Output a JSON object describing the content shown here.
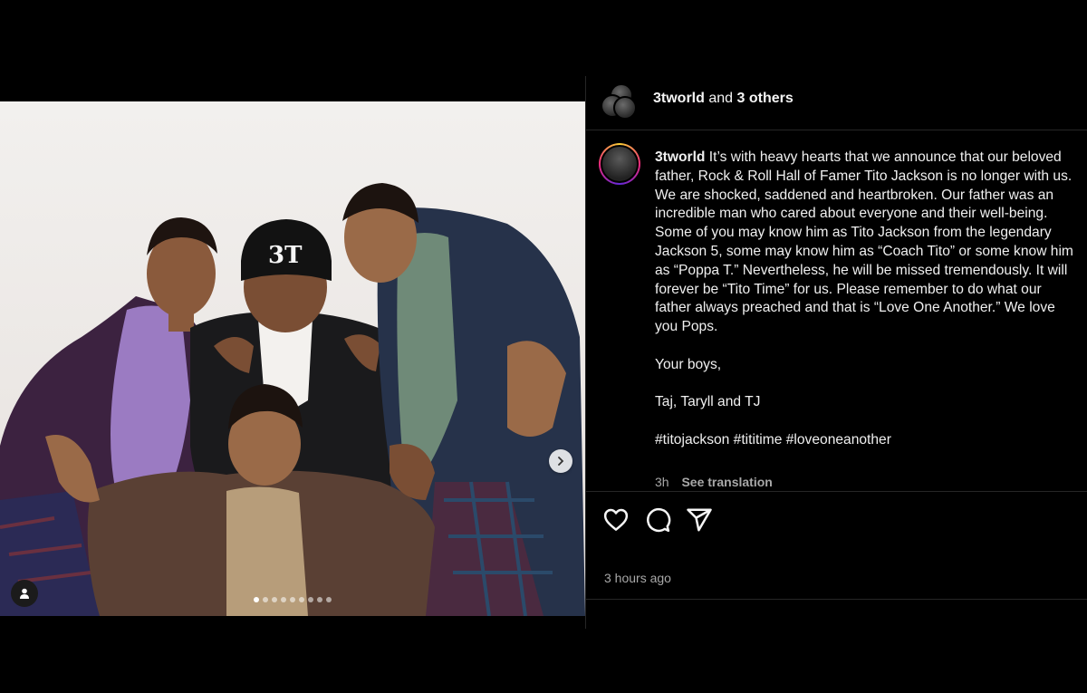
{
  "header": {
    "username": "3tworld",
    "connector": "and",
    "others": "3 others"
  },
  "post": {
    "username": "3tworld",
    "caption_body": "It’s with heavy hearts that we announce that our beloved father, Rock & Roll Hall of Famer Tito Jackson is no longer with us. We are shocked, saddened and heartbroken. Our father was an incredible man who cared about everyone and their well-being. Some of you may know him as Tito Jackson from the legendary Jackson 5, some may know him as “Coach Tito” or some know him as “Poppa T.” Nevertheless, he will be missed tremendously. It will forever be “Tito Time” for us. Please remember to do what our father always preached and that is “Love One Another.” We love you Pops.",
    "signoff": "Your boys,",
    "names": "Taj, Taryll and TJ",
    "hashtags": "#titojackson #tititime #loveoneanother",
    "age": "3h",
    "see_translation": "See translation",
    "timestamp": "3 hours ago"
  },
  "carousel": {
    "slide_count": 9,
    "active_index": 0
  },
  "icons": {
    "like": "heart-icon",
    "comment": "comment-icon",
    "share": "share-icon",
    "next": "chevron-right-icon",
    "tag": "user-tag-icon"
  },
  "colors": {
    "background": "#000000",
    "text": "#f5f5f5",
    "muted": "#a8a8a8",
    "divider": "#262626"
  }
}
